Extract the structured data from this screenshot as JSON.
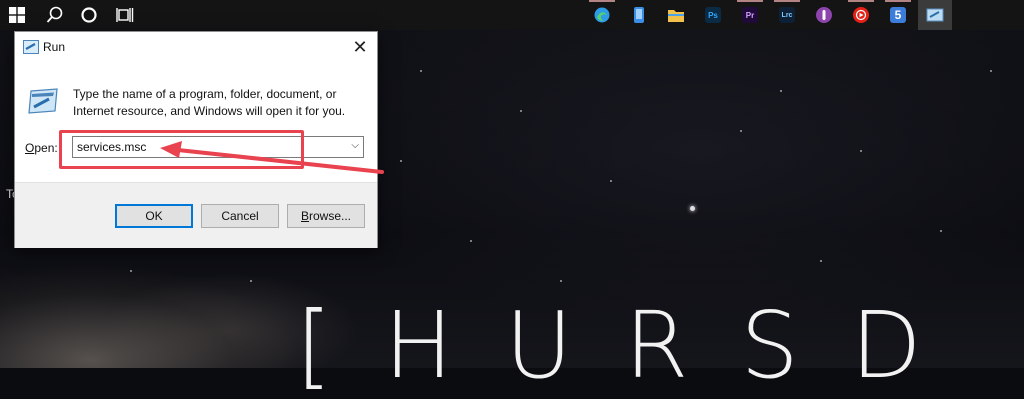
{
  "taskbar": {
    "start_icon": "windows-logo-icon",
    "search_icon": "search-icon",
    "cortana_icon": "circle-icon",
    "taskview_icon": "task-view-icon",
    "apps": [
      {
        "name": "edge-icon",
        "label": "",
        "color": "#2e9be6"
      },
      {
        "name": "phone-icon",
        "label": "",
        "color": "#3a8ee6"
      },
      {
        "name": "file-explorer-icon",
        "label": "",
        "color": "#f0c24b"
      },
      {
        "name": "photoshop-icon",
        "label": "Ps",
        "color": "#0b2a44"
      },
      {
        "name": "premiere-icon",
        "label": "Pr",
        "color": "#1f0a3a"
      },
      {
        "name": "lightroom-classic-icon",
        "label": "Lrc",
        "color": "#0d2035"
      },
      {
        "name": "podcast-icon",
        "label": "",
        "color": "#8e44ad"
      },
      {
        "name": "youtube-music-icon",
        "label": "",
        "color": "#e62117"
      },
      {
        "name": "s-app-icon",
        "label": "5",
        "color": "#3b7dd8"
      },
      {
        "name": "run-app-icon",
        "label": "",
        "color": "#6aa6d6"
      }
    ]
  },
  "run_dialog": {
    "title": "Run",
    "description": "Type the name of a program, folder, document, or Internet resource, and Windows will open it for you.",
    "open_label_prefix": "O",
    "open_label_rest": "pen:",
    "open_value": "services.msc",
    "ok_label": "OK",
    "cancel_label": "Cancel",
    "browse_prefix": "B",
    "browse_rest": "rowse..."
  },
  "desktop": {
    "edge_text": "To",
    "brand_glyphs": [
      "[",
      "H",
      "U",
      "R",
      "S",
      "D"
    ]
  },
  "annotation": {
    "highlight_color": "#e8434f"
  }
}
